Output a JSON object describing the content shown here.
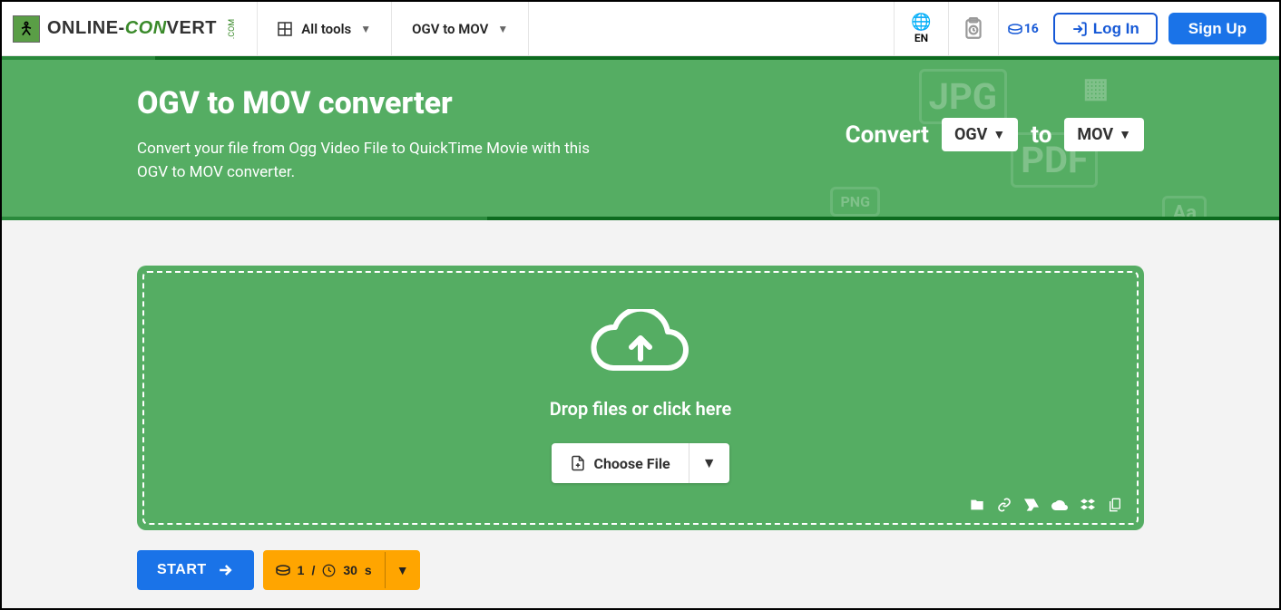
{
  "header": {
    "brand_pre": "ONLINE-",
    "brand_mid": "CON",
    "brand_suf": "VERT",
    "brand_tld": ".COM",
    "nav_all_tools": "All tools",
    "nav_converter": "OGV to MOV",
    "lang": "EN",
    "coins": "16",
    "login": "Log In",
    "signup": "Sign Up"
  },
  "hero": {
    "title": "OGV to MOV converter",
    "subtitle": "Convert your file from Ogg Video File to QuickTime Movie with this OGV to MOV converter.",
    "convert_label": "Convert",
    "from": "OGV",
    "to_label": "to",
    "to": "MOV"
  },
  "drop": {
    "text": "Drop files or click here",
    "choose": "Choose File"
  },
  "actions": {
    "start": "START",
    "cost_coins": "1",
    "cost_sep": "/",
    "cost_time": "30",
    "cost_unit": "s"
  }
}
